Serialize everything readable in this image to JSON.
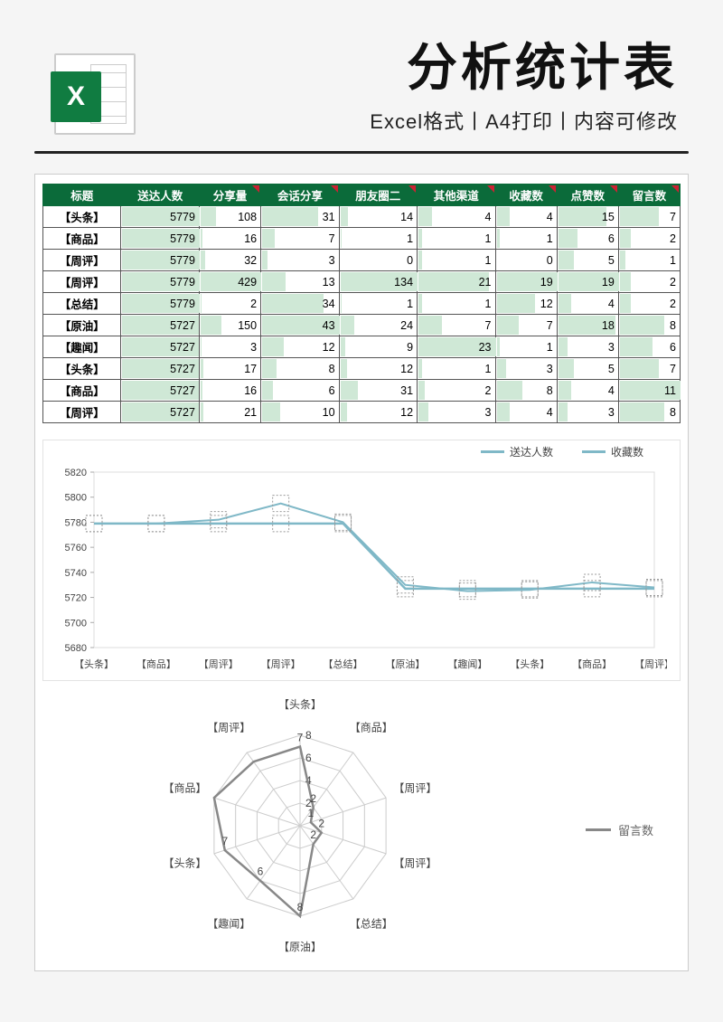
{
  "header": {
    "title": "分析统计表",
    "subtitle": "Excel格式丨A4打印丨内容可修改",
    "icon_text": "X"
  },
  "table": {
    "columns": [
      "标题",
      "送达人数",
      "分享量",
      "会话分享",
      "朋友圈二",
      "其他渠道",
      "收藏数",
      "点赞数",
      "留言数"
    ],
    "comment_cols": [
      2,
      3,
      4,
      5,
      6,
      7,
      8
    ],
    "rows": [
      {
        "label": "【头条】",
        "vals": [
          5779,
          108,
          31,
          14,
          4,
          4,
          15,
          7
        ]
      },
      {
        "label": "【商品】",
        "vals": [
          5779,
          16,
          7,
          1,
          1,
          1,
          6,
          2
        ]
      },
      {
        "label": "【周评】",
        "vals": [
          5779,
          32,
          3,
          0,
          1,
          0,
          5,
          1
        ]
      },
      {
        "label": "【周评】",
        "vals": [
          5779,
          429,
          13,
          134,
          21,
          19,
          19,
          2
        ]
      },
      {
        "label": "【总结】",
        "vals": [
          5779,
          2,
          34,
          1,
          1,
          12,
          4,
          2
        ]
      },
      {
        "label": "【原油】",
        "vals": [
          5727,
          150,
          43,
          24,
          7,
          7,
          18,
          8
        ]
      },
      {
        "label": "【趣闻】",
        "vals": [
          5727,
          3,
          12,
          9,
          23,
          1,
          3,
          6
        ]
      },
      {
        "label": "【头条】",
        "vals": [
          5727,
          17,
          8,
          12,
          1,
          3,
          5,
          7
        ]
      },
      {
        "label": "【商品】",
        "vals": [
          5727,
          16,
          6,
          31,
          2,
          8,
          4,
          11
        ]
      },
      {
        "label": "【周评】",
        "vals": [
          5727,
          21,
          10,
          12,
          3,
          4,
          3,
          8
        ]
      }
    ]
  },
  "chart_data": [
    {
      "type": "line",
      "title": "",
      "xlabel": "",
      "ylabel": "",
      "ylim": [
        5680,
        5820
      ],
      "yticks": [
        5680,
        5700,
        5720,
        5740,
        5760,
        5780,
        5800,
        5820
      ],
      "categories": [
        "【头条】",
        "【商品】",
        "【周评】",
        "【周评】",
        "【总结】",
        "【原油】",
        "【趣闻】",
        "【头条】",
        "【商品】",
        "【周评】"
      ],
      "series": [
        {
          "name": "送达人数",
          "values": [
            5779,
            5779,
            5779,
            5779,
            5779,
            5727,
            5727,
            5727,
            5727,
            5727
          ]
        },
        {
          "name": "收藏数",
          "values": [
            5779,
            5779,
            5782,
            5795,
            5780,
            5730,
            5725,
            5726,
            5732,
            5728
          ]
        }
      ],
      "legend": [
        "送达人数",
        "收藏数"
      ]
    },
    {
      "type": "radar",
      "title": "",
      "series_name": "留言数",
      "max": 8,
      "ticks": [
        2,
        4,
        6,
        8
      ],
      "axes": [
        "【头条】",
        "【商品】",
        "【周评】",
        "【周评】",
        "【总结】",
        "【原油】",
        "【趣闻】",
        "【头条】",
        "【商品】",
        "【周评】"
      ],
      "values": [
        7,
        2,
        1,
        2,
        2,
        8,
        6,
        7,
        8,
        7
      ],
      "point_labels": [
        7,
        2,
        1,
        2,
        2,
        8,
        6,
        7,
        null,
        null
      ]
    }
  ],
  "colors": {
    "header_green": "#0b6b3a",
    "bar_fill": "#cfe8d6",
    "line": "#7fb8c7",
    "radar_line": "#888888"
  }
}
